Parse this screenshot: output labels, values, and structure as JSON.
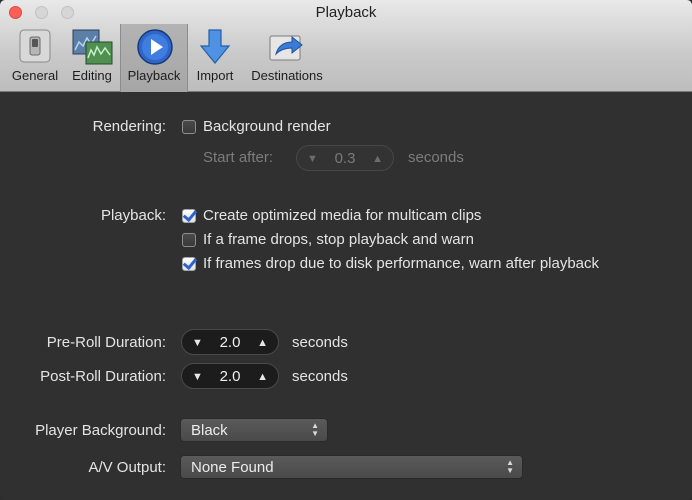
{
  "window": {
    "title": "Playback"
  },
  "toolbar": {
    "items": [
      {
        "label": "General"
      },
      {
        "label": "Editing"
      },
      {
        "label": "Playback"
      },
      {
        "label": "Import"
      },
      {
        "label": "Destinations"
      }
    ]
  },
  "rendering": {
    "label": "Rendering:",
    "background_render": {
      "label": "Background render",
      "checked": false
    },
    "start_after": {
      "label": "Start after:",
      "value": "0.3",
      "unit": "seconds"
    }
  },
  "playback": {
    "label": "Playback:",
    "options": [
      {
        "label": "Create optimized media for multicam clips",
        "checked": true
      },
      {
        "label": "If a frame drops, stop playback and warn",
        "checked": false
      },
      {
        "label": "If frames drop due to disk performance, warn after playback",
        "checked": true
      }
    ]
  },
  "pre_roll": {
    "label": "Pre-Roll Duration:",
    "value": "2.0",
    "unit": "seconds"
  },
  "post_roll": {
    "label": "Post-Roll Duration:",
    "value": "2.0",
    "unit": "seconds"
  },
  "player_background": {
    "label": "Player Background:",
    "value": "Black"
  },
  "av_output": {
    "label": "A/V Output:",
    "value": "None Found"
  },
  "icons": {
    "stepper_down": "▼",
    "stepper_up": "▲",
    "popup_up": "▲",
    "popup_down": "▼"
  }
}
